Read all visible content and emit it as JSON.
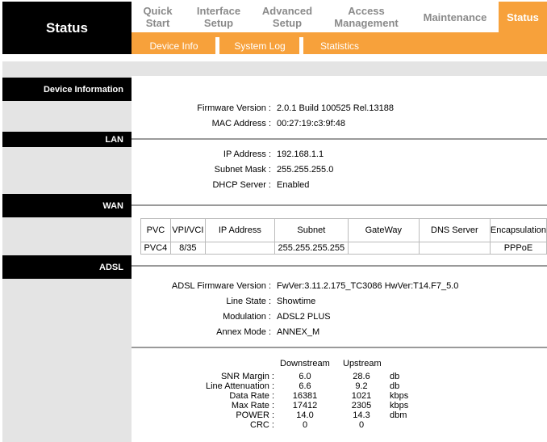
{
  "header": {
    "brand": "Status",
    "tabs": [
      {
        "line1": "Quick",
        "line2": "Start"
      },
      {
        "line1": "Interface",
        "line2": "Setup"
      },
      {
        "line1": "Advanced",
        "line2": "Setup"
      },
      {
        "line1": "Access",
        "line2": "Management"
      },
      {
        "line1": "Maintenance",
        "line2": ""
      },
      {
        "line1": "Status",
        "line2": ""
      }
    ],
    "subtabs": [
      "Device Info",
      "System Log",
      "Statistics"
    ]
  },
  "device_info": {
    "section_label": "Device Information",
    "firmware_label": "Firmware Version :",
    "firmware_value": "2.0.1 Build 100525 Rel.13188",
    "mac_label": "MAC Address :",
    "mac_value": "00:27:19:c3:9f:48"
  },
  "lan": {
    "section_label": "LAN",
    "ip_label": "IP Address :",
    "ip_value": "192.168.1.1",
    "mask_label": "Subnet Mask :",
    "mask_value": "255.255.255.0",
    "dhcp_label": "DHCP Server :",
    "dhcp_value": "Enabled"
  },
  "wan": {
    "section_label": "WAN",
    "columns": [
      "PVC",
      "VPI/VCI",
      "IP Address",
      "Subnet",
      "GateWay",
      "DNS Server",
      "Encapsulation"
    ],
    "rows": [
      [
        "PVC4",
        "8/35",
        "",
        "255.255.255.255",
        "",
        "",
        "PPPoE"
      ]
    ]
  },
  "adsl": {
    "section_label": "ADSL",
    "fw_label": "ADSL Firmware Version :",
    "fw_value": "FwVer:3.11.2.175_TC3086 HwVer:T14.F7_5.0",
    "state_label": "Line State :",
    "state_value": "Showtime",
    "mod_label": "Modulation :",
    "mod_value": "ADSL2 PLUS",
    "annex_label": "Annex Mode :",
    "annex_value": "ANNEX_M",
    "stats_headers": {
      "down": "Downstream",
      "up": "Upstream"
    },
    "stats": [
      {
        "label": "SNR Margin :",
        "down": "6.0",
        "up": "28.6",
        "unit": "db"
      },
      {
        "label": "Line Attenuation :",
        "down": "6.6",
        "up": "9.2",
        "unit": "db"
      },
      {
        "label": "Data Rate :",
        "down": "16381",
        "up": "1021",
        "unit": "kbps"
      },
      {
        "label": "Max Rate :",
        "down": "17412",
        "up": "2305",
        "unit": "kbps"
      },
      {
        "label": "POWER :",
        "down": "14.0",
        "up": "14.3",
        "unit": "dbm"
      },
      {
        "label": "CRC :",
        "down": "0",
        "up": "0",
        "unit": ""
      }
    ]
  },
  "colors": {
    "accent": "#f7a13b",
    "header_bg": "#000000",
    "panel_grey": "#e4e4e4"
  }
}
